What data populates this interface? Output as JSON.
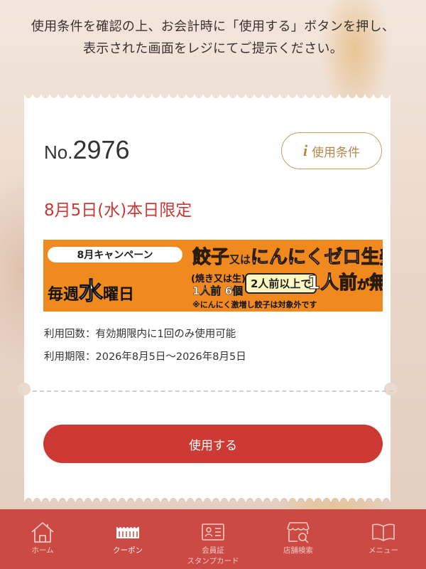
{
  "notice": {
    "line1": "使用条件を確認の上、お会計時に「使用する」ボタンを押し、",
    "line2": "表示された画面をレジにてご提示ください。"
  },
  "coupon": {
    "number_prefix": "No.",
    "number": "2976",
    "terms_button_label": "使用条件",
    "terms_icon": "info-icon",
    "valid_day": "8月5日(水)本日限定",
    "banner": {
      "campaign": "8月キャンペーン",
      "weekly_prefix": "毎週",
      "weekly_big": "水",
      "weekly_suffix": "曜日",
      "product_1": "餃子",
      "product_or": "又は",
      "product_2": "にんにくゼロ生姜餃子",
      "note_type": "(焼き又は生)",
      "note_qty": "1人前 6個",
      "min_order": "2人前以上で",
      "free_1": "1人前",
      "free_ga": "が",
      "free_2": "無料",
      "exclusion": "※にんにく激増し餃子は対象外です"
    },
    "usage_count_label": "利用回数：有効期限内に1回のみ使用可能",
    "usage_period_label": "利用期限：2026年8月5日〜2026年8月5日",
    "use_button_label": "使用する"
  },
  "tabbar": {
    "items": [
      {
        "label": "ホーム",
        "icon": "home-icon",
        "active": false
      },
      {
        "label": "クーポン",
        "icon": "coupon-icon",
        "active": true
      },
      {
        "label_line1": "会員証",
        "label_line2": "スタンプカード",
        "icon": "member-card-icon",
        "active": false
      },
      {
        "label": "店舗検索",
        "icon": "store-search-icon",
        "active": false
      },
      {
        "label": "メニュー",
        "icon": "menu-book-icon",
        "active": false
      }
    ]
  },
  "colors": {
    "accent_red": "#cc3a33",
    "tabbar_red": "#cb4a44",
    "gold": "#b5884a",
    "banner_orange": "#f0891e"
  }
}
